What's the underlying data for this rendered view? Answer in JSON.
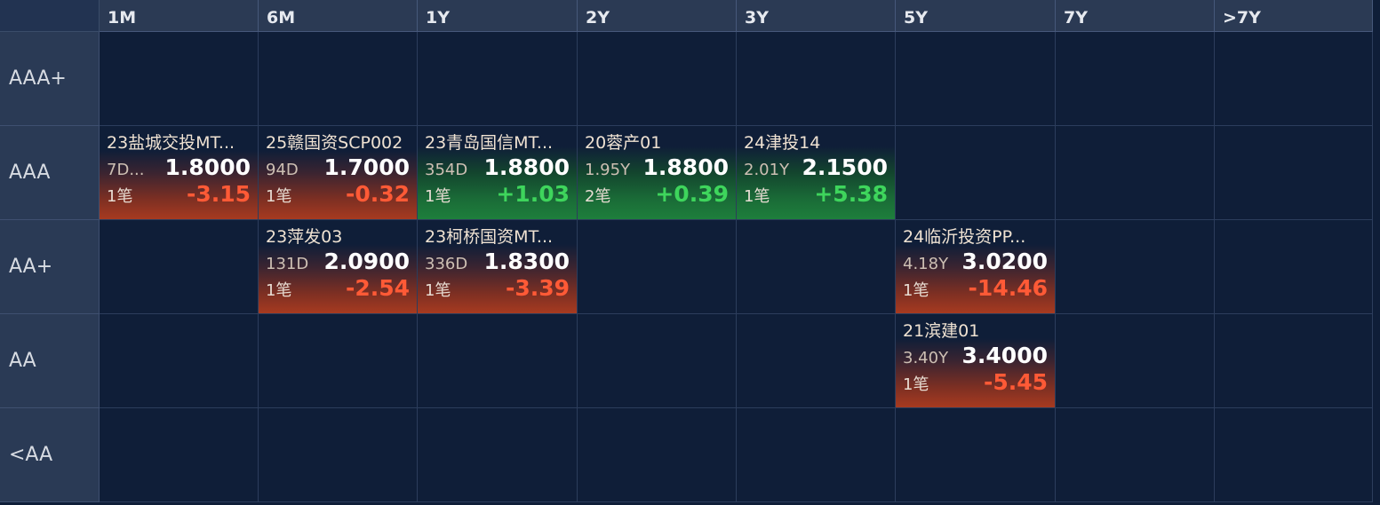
{
  "columns": [
    "1M",
    "6M",
    "1Y",
    "2Y",
    "3Y",
    "5Y",
    "7Y",
    ">7Y"
  ],
  "rows": [
    "AAA+",
    "AAA",
    "AA+",
    "AA",
    "<AA"
  ],
  "colors": {
    "negative": "#ff5a36",
    "positive": "#3ed55c",
    "header_bg": "#2b3a54",
    "grid_bg": "#0f1e38"
  },
  "cards": [
    {
      "row": 1,
      "col": 0,
      "name": "23盐城交投MT...",
      "term": "7D...",
      "price": "1.8000",
      "count": "1笔",
      "change": "-3.15",
      "trend": "down"
    },
    {
      "row": 1,
      "col": 1,
      "name": "25赣国资SCP002",
      "term": "94D",
      "price": "1.7000",
      "count": "1笔",
      "change": "-0.32",
      "trend": "down"
    },
    {
      "row": 1,
      "col": 2,
      "name": "23青岛国信MT...",
      "term": "354D",
      "price": "1.8800",
      "count": "1笔",
      "change": "+1.03",
      "trend": "up"
    },
    {
      "row": 1,
      "col": 3,
      "name": "20蓉产01",
      "term": "1.95Y",
      "price": "1.8800",
      "count": "2笔",
      "change": "+0.39",
      "trend": "up"
    },
    {
      "row": 1,
      "col": 4,
      "name": "24津投14",
      "term": "2.01Y",
      "price": "2.1500",
      "count": "1笔",
      "change": "+5.38",
      "trend": "up"
    },
    {
      "row": 2,
      "col": 1,
      "name": "23萍发03",
      "term": "131D",
      "price": "2.0900",
      "count": "1笔",
      "change": "-2.54",
      "trend": "down"
    },
    {
      "row": 2,
      "col": 2,
      "name": "23柯桥国资MT...",
      "term": "336D",
      "price": "1.8300",
      "count": "1笔",
      "change": "-3.39",
      "trend": "down"
    },
    {
      "row": 2,
      "col": 5,
      "name": "24临沂投资PP...",
      "term": "4.18Y",
      "price": "3.0200",
      "count": "1笔",
      "change": "-14.46",
      "trend": "down"
    },
    {
      "row": 3,
      "col": 5,
      "name": "21滨建01",
      "term": "3.40Y",
      "price": "3.4000",
      "count": "1笔",
      "change": "-5.45",
      "trend": "down"
    }
  ]
}
